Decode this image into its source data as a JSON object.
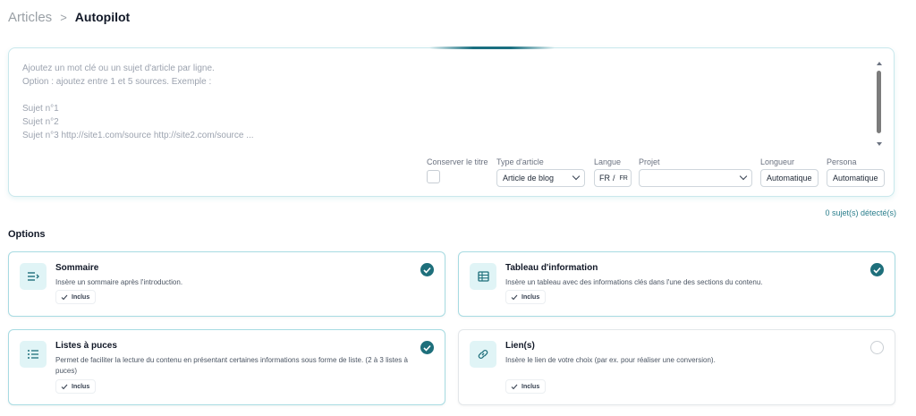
{
  "breadcrumb": {
    "parent": "Articles",
    "separator": ">",
    "current": "Autopilot"
  },
  "editor": {
    "placeholder": "Ajoutez un mot clé ou un sujet d'article par ligne.\nOption : ajoutez entre 1 et 5 sources. Exemple :\n\nSujet n°1\nSujet n°2\nSujet n°3 http://site1.com/source http://site2.com/source ...",
    "fields": {
      "keep_title_label": "Conserver le titre",
      "keep_title_checked": false,
      "article_type_label": "Type d'article",
      "article_type_value": "Article de blog",
      "language_label": "Langue",
      "language_value": "FR",
      "language_separator": "/",
      "language_sub": "FR",
      "project_label": "Projet",
      "project_value": "",
      "length_label": "Longueur",
      "length_value": "Automatique",
      "persona_label": "Persona",
      "persona_value": "Automatique"
    }
  },
  "detected_text": "0 sujet(s) détecté(s)",
  "options_title": "Options",
  "options": [
    {
      "title": "Sommaire",
      "description": "Insère un sommaire après l'introduction.",
      "badge": "Inclus",
      "selected": true,
      "icon": "toc-icon"
    },
    {
      "title": "Tableau d'information",
      "description": "Insère un tableau avec des informations clés dans l'une des sections du contenu.",
      "badge": "Inclus",
      "selected": true,
      "icon": "table-icon"
    },
    {
      "title": "Listes à puces",
      "description": "Permet de faciliter la lecture du contenu en présentant certaines informations sous forme de liste. (2 à 3 listes à puces)",
      "badge": "Inclus",
      "selected": true,
      "icon": "list-icon"
    },
    {
      "title": "Lien(s)",
      "description": "Insère le lien de votre choix (par ex. pour réaliser une conversion).",
      "badge": "Inclus",
      "selected": false,
      "icon": "link-icon"
    }
  ],
  "colors": {
    "accent": "#1e6f7b",
    "icon_bg": "#e0f4f6",
    "card_border": "#a7dbe2",
    "link": "#2a7e8c"
  }
}
